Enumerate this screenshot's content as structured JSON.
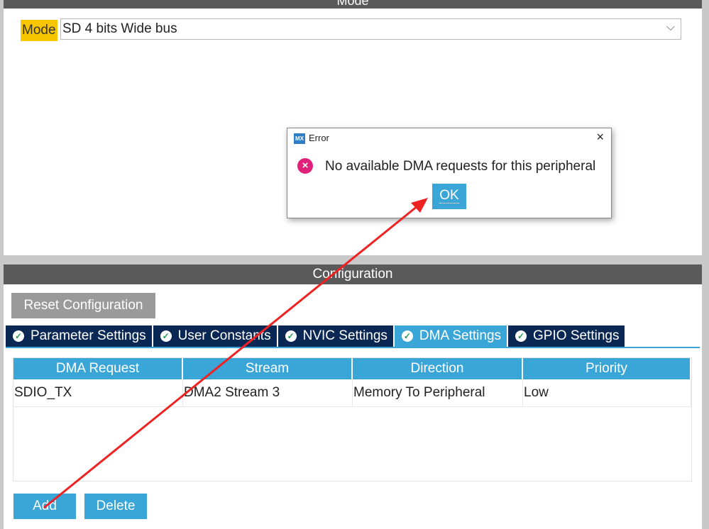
{
  "mode_panel": {
    "header": "Mode",
    "mode_label": "Mode",
    "mode_value": "SD 4 bits Wide bus"
  },
  "configuration": {
    "header": "Configuration",
    "reset_button": "Reset Configuration",
    "tabs": [
      {
        "label": "Parameter Settings",
        "active": false
      },
      {
        "label": "User Constants",
        "active": false
      },
      {
        "label": "NVIC Settings",
        "active": false
      },
      {
        "label": "DMA Settings",
        "active": true
      },
      {
        "label": "GPIO Settings",
        "active": false
      }
    ],
    "dma_table": {
      "columns": [
        "DMA Request",
        "Stream",
        "Direction",
        "Priority"
      ],
      "rows": [
        [
          "SDIO_TX",
          "DMA2 Stream 3",
          "Memory To Peripheral",
          "Low"
        ]
      ]
    },
    "add_button": "Add",
    "delete_button": "Delete"
  },
  "error_dialog": {
    "app_icon": "MX",
    "title": "Error",
    "close_icon": "×",
    "error_icon": "×",
    "message": "No available DMA requests for this peripheral",
    "ok_button": "OK"
  },
  "colors": {
    "accent": "#3aa6d8",
    "tab_dark": "#0b2855",
    "mode_highlight": "#f7c600",
    "error": "#e0217a",
    "annotation_arrow": "#ee2222"
  }
}
